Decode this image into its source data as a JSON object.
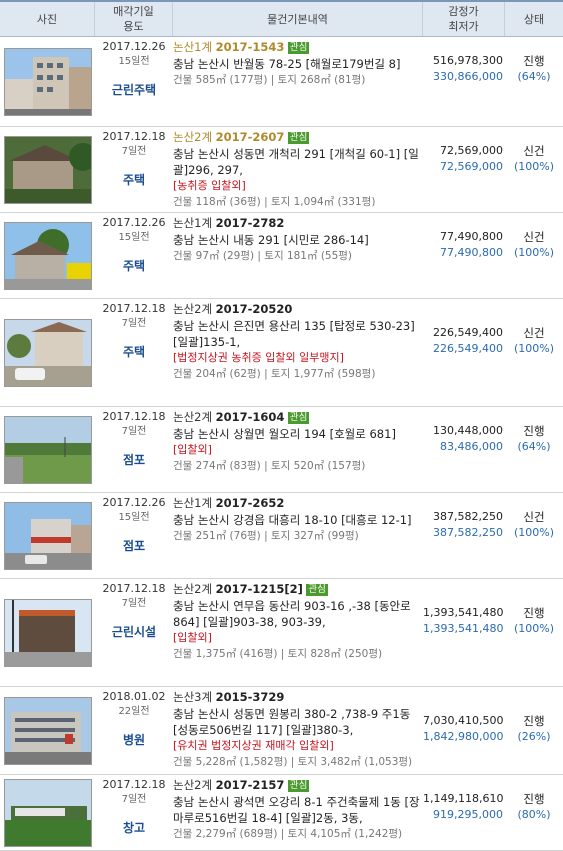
{
  "header": {
    "photo": "사진",
    "date_usage_line1": "매각기일",
    "date_usage_line2": "용도",
    "details": "물건기본내역",
    "price_line1": "감정가",
    "price_line2": "최저가",
    "status": "상태"
  },
  "items": [
    {
      "date": "2017.12.26",
      "ago": "15일전",
      "usage": "근린주택",
      "court": "논산1계",
      "case_no": "2017-1543",
      "case_gold": true,
      "badge": "관심",
      "address": "충남 논산시 반월동 78-25 [해월로179번길 8]",
      "tags": "",
      "area": "건물 585㎡ (177평) | 토지 268㎡ (81평)",
      "appraisal": "516,978,300",
      "minimum": "330,866,000",
      "status": "진행",
      "percent": "(64%)"
    },
    {
      "date": "2017.12.18",
      "ago": "7일전",
      "usage": "주택",
      "court": "논산2계",
      "case_no": "2017-2607",
      "case_gold": true,
      "badge": "관심",
      "address": "충남 논산시 성동면 개척리 291 [개척길 60-1] [일괄]296, 297,",
      "tags": "[농취증  입찰외]",
      "area": "건물 118㎡ (36평) | 토지 1,094㎡ (331평)",
      "appraisal": "72,569,000",
      "minimum": "72,569,000",
      "status": "신건",
      "percent": "(100%)"
    },
    {
      "date": "2017.12.26",
      "ago": "15일전",
      "usage": "주택",
      "court": "논산1계",
      "case_no": "2017-2782",
      "case_gold": false,
      "badge": "",
      "address": "충남 논산시 내동 291 [시민로 286-14]",
      "tags": "",
      "area": "건물 97㎡ (29평) | 토지 181㎡ (55평)",
      "appraisal": "77,490,800",
      "minimum": "77,490,800",
      "status": "신건",
      "percent": "(100%)"
    },
    {
      "date": "2017.12.18",
      "ago": "7일전",
      "usage": "주택",
      "court": "논산2계",
      "case_no": "2017-20520",
      "case_gold": false,
      "badge": "",
      "address": "충남 논산시 은진면 용산리 135 [탑정로 530-23] [일괄]135-1,",
      "tags": "[법정지상권  농취증  입찰외  일부맹지]",
      "area": "건물 204㎡ (62평) | 토지 1,977㎡ (598평)",
      "appraisal": "226,549,400",
      "minimum": "226,549,400",
      "status": "신건",
      "percent": "(100%)"
    },
    {
      "date": "2017.12.18",
      "ago": "7일전",
      "usage": "점포",
      "court": "논산2계",
      "case_no": "2017-1604",
      "case_gold": false,
      "badge": "관심",
      "address": "충남 논산시 상월면 월오리 194 [호월로 681]",
      "tags": "[입찰외]",
      "area": "건물 274㎡ (83평) | 토지 520㎡ (157평)",
      "appraisal": "130,448,000",
      "minimum": "83,486,000",
      "status": "진행",
      "percent": "(64%)"
    },
    {
      "date": "2017.12.26",
      "ago": "15일전",
      "usage": "점포",
      "court": "논산1계",
      "case_no": "2017-2652",
      "case_gold": false,
      "badge": "",
      "address": "충남 논산시 강경읍 대흥리 18-10 [대흥로 12-1]",
      "tags": "",
      "area": "건물 251㎡ (76평) | 토지 327㎡ (99평)",
      "appraisal": "387,582,250",
      "minimum": "387,582,250",
      "status": "신건",
      "percent": "(100%)"
    },
    {
      "date": "2017.12.18",
      "ago": "7일전",
      "usage": "근린시설",
      "court": "논산2계",
      "case_no": "2017-1215[2]",
      "case_gold": false,
      "badge": "관심",
      "address": "충남 논산시 연무읍 동산리 903-16 ,-38 [동안로 864] [일괄]903-38, 903-39,",
      "tags": "[입찰외]",
      "area": "건물 1,375㎡ (416평) | 토지 828㎡ (250평)",
      "appraisal": "1,393,541,480",
      "minimum": "1,393,541,480",
      "status": "진행",
      "percent": "(100%)"
    },
    {
      "date": "2018.01.02",
      "ago": "22일전",
      "usage": "병원",
      "court": "논산3계",
      "case_no": "2015-3729",
      "case_gold": false,
      "badge": "",
      "address": "충남 논산시 성동면 원봉리 380-2 ,738-9 주1동 [성동로506번길 117] [일괄]380-3,",
      "tags": "[유치권  법정지상권  재매각  입찰외]",
      "area": "건물 5,228㎡ (1,582평) | 토지 3,482㎡ (1,053평)",
      "appraisal": "7,030,410,500",
      "minimum": "1,842,980,000",
      "status": "진행",
      "percent": "(26%)"
    },
    {
      "date": "2017.12.18",
      "ago": "7일전",
      "usage": "창고",
      "court": "논산2계",
      "case_no": "2017-2157",
      "case_gold": false,
      "badge": "관심",
      "address": "충남 논산시 광석면 오강리 8-1 주건축물제 1동 [장마루로516번길 18-4] [일괄]2동, 3동,",
      "tags": "",
      "area": "건물 2,279㎡ (689평) | 토지 4,105㎡ (1,242평)",
      "appraisal": "1,149,118,610",
      "minimum": "919,295,000",
      "status": "진행",
      "percent": "(80%)"
    }
  ]
}
